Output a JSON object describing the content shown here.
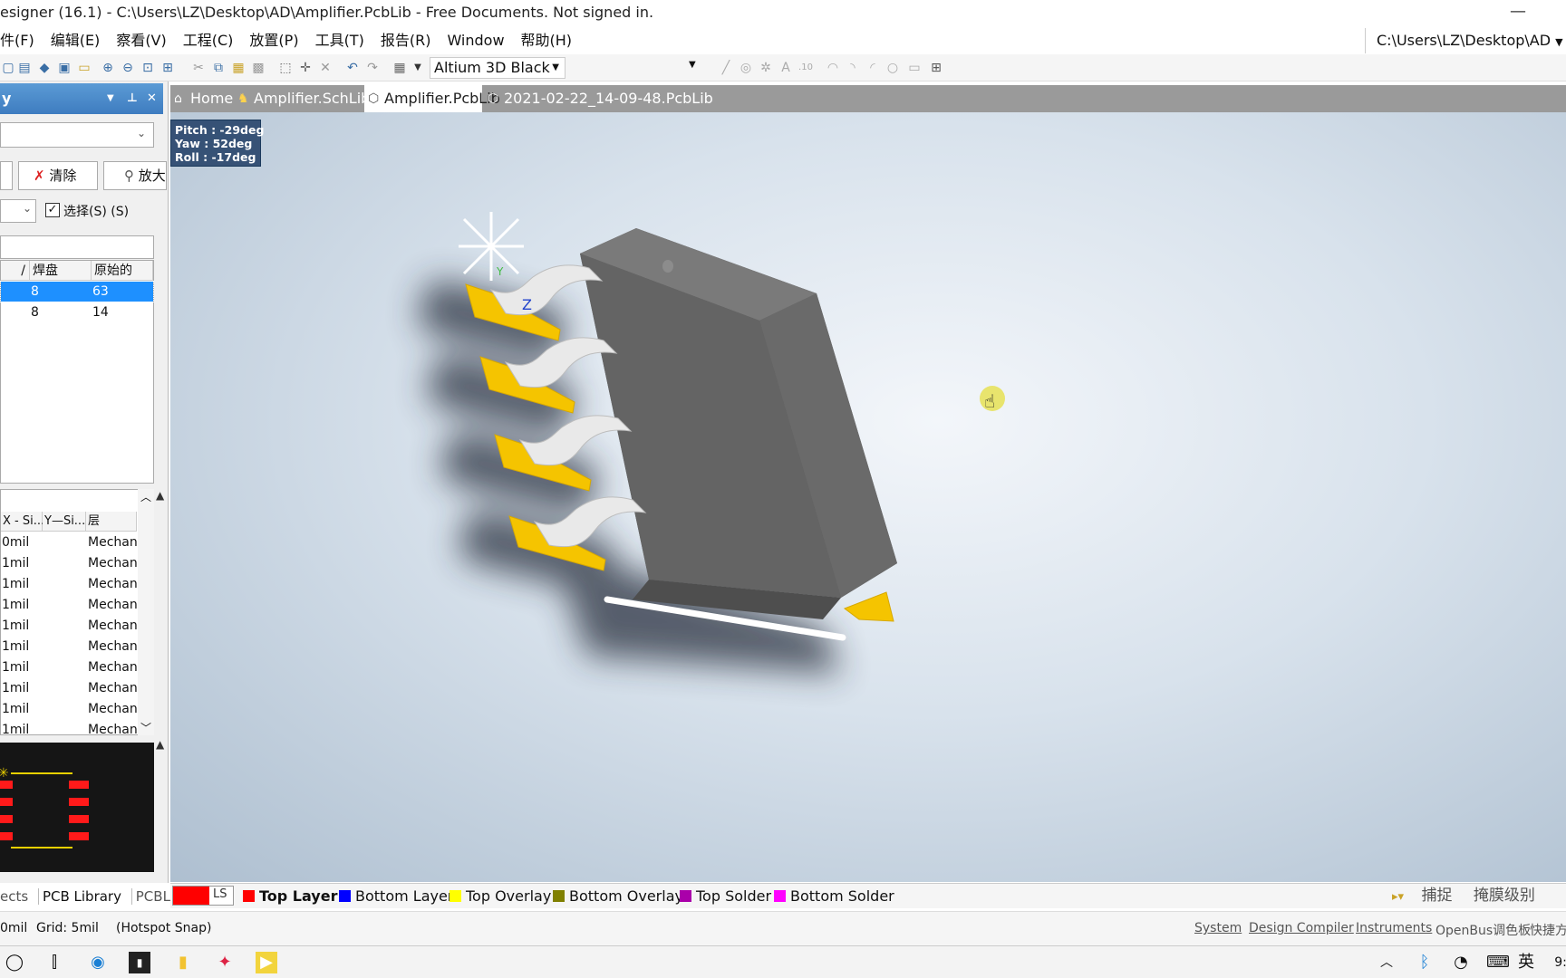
{
  "window": {
    "title": "esigner (16.1) - C:\\Users\\LZ\\Desktop\\AD\\Amplifier.PcbLib - Free Documents. Not signed in.",
    "minimize": "—"
  },
  "menubar": {
    "items": [
      "件(F)",
      "编辑(E)",
      "察看(V)",
      "工程(C)",
      "放置(P)",
      "工具(T)",
      "报告(R)",
      "Window",
      "帮助(H)"
    ],
    "path": "C:\\Users\\LZ\\Desktop\\AD"
  },
  "toolbar": {
    "theme": "Altium 3D Black"
  },
  "panel": {
    "title": "y",
    "clear_button": "清除",
    "zoom_button": "放大",
    "select_label": "选择(S) (S)",
    "table1": {
      "headers": [
        "/",
        "焊盘",
        "原始的"
      ],
      "rows": [
        {
          "pads": "8",
          "primitives": "63",
          "selected": true
        },
        {
          "pads": "8",
          "primitives": "14",
          "selected": false
        }
      ]
    },
    "table2": {
      "headers": [
        "X - Si...",
        "Y—Si...",
        "层"
      ],
      "rows": [
        {
          "x": "0mil",
          "layer": "Mechan"
        },
        {
          "x": "1mil",
          "layer": "Mechan"
        },
        {
          "x": "1mil",
          "layer": "Mechan"
        },
        {
          "x": "1mil",
          "layer": "Mechan"
        },
        {
          "x": "1mil",
          "layer": "Mechan"
        },
        {
          "x": "1mil",
          "layer": "Mechan"
        },
        {
          "x": "1mil",
          "layer": "Mechan"
        },
        {
          "x": "1mil",
          "layer": "Mechan"
        },
        {
          "x": "1mil",
          "layer": "Mechan"
        },
        {
          "x": "1mil",
          "layer": "Mechan"
        }
      ]
    },
    "tabs": [
      "ects",
      "PCB Library",
      "PCBLIB"
    ]
  },
  "doctabs": [
    {
      "label": "Home",
      "icon": "home-icon",
      "active": false
    },
    {
      "label": "Amplifier.SchLib",
      "icon": "schlib-icon",
      "active": false
    },
    {
      "label": "Amplifier.PcbLib",
      "icon": "pcblib-icon",
      "active": true
    },
    {
      "label": "2021-02-22_14-09-48.PcbLib",
      "icon": "pcblib-icon",
      "active": false
    }
  ],
  "view3d": {
    "pitch": "Pitch : -29deg",
    "yaw": "Yaw : 52deg",
    "roll": "Roll : -17deg",
    "axis_y": "Y",
    "axis_z": "Z"
  },
  "layers": {
    "current": "LS",
    "items": [
      {
        "name": "Top Layer",
        "color": "#ff0000",
        "bold": true
      },
      {
        "name": "Bottom Layer",
        "color": "#0000ff",
        "bold": false
      },
      {
        "name": "Top Overlay",
        "color": "#ffff00",
        "bold": false
      },
      {
        "name": "Bottom Overlay",
        "color": "#808000",
        "bold": false
      },
      {
        "name": "Top Solder",
        "color": "#aa00aa",
        "bold": false
      },
      {
        "name": "Bottom Solder",
        "color": "#ff00ff",
        "bold": false
      }
    ],
    "snap": "捕捉",
    "mask": "掩膜级别"
  },
  "status": {
    "coords": "0mil",
    "grid": "Grid: 5mil",
    "snap": "(Hotspot Snap)",
    "links": [
      "System",
      "Design Compiler",
      "Instruments",
      "OpenBus调色板",
      "快捷方"
    ]
  },
  "taskbar": {
    "ime": "英",
    "clock": "9:"
  }
}
